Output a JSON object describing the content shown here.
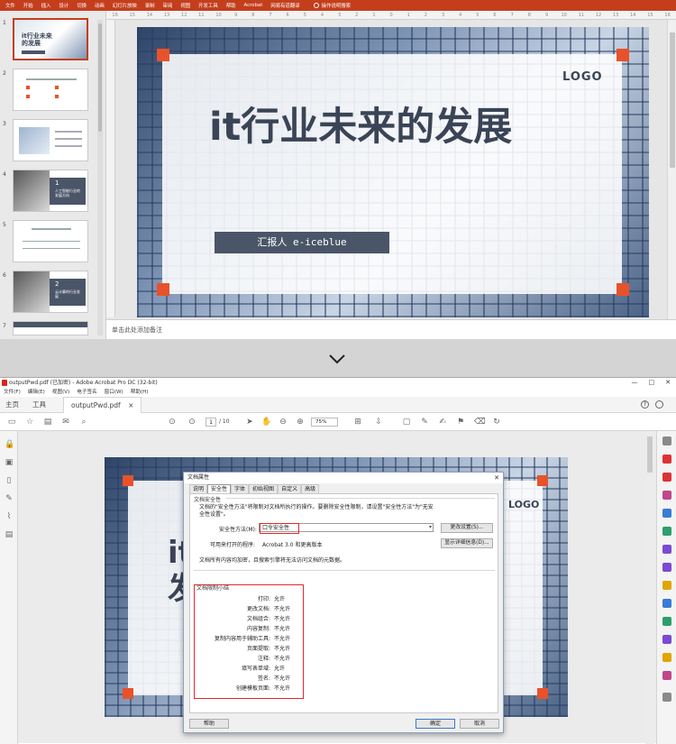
{
  "ppt": {
    "ribbon_tabs": [
      "文件",
      "开始",
      "插入",
      "设计",
      "切换",
      "动画",
      "幻灯片放映",
      "录制",
      "审阅",
      "视图",
      "开发工具",
      "帮助",
      "Acrobat",
      "网易有道翻译"
    ],
    "tell_me": "操作说明搜索",
    "ruler": [
      "16",
      "15",
      "14",
      "13",
      "12",
      "11",
      "10",
      "9",
      "8",
      "7",
      "6",
      "5",
      "4",
      "3",
      "2",
      "1",
      "0",
      "1",
      "2",
      "3",
      "4",
      "5",
      "6",
      "7",
      "8",
      "9",
      "10",
      "11",
      "12",
      "13",
      "14",
      "15",
      "16"
    ],
    "thumb_numbers": [
      "1",
      "2",
      "3",
      "4",
      "5",
      "6",
      "7"
    ],
    "thumb_texts": {
      "t1_title": "it行业未来的发展",
      "t4_num": "1",
      "t4_text": "人工智能行业的发展方向",
      "t6_num": "2",
      "t6_text": "云计算的行业发展"
    },
    "slide": {
      "title": "it行业未来的发展",
      "logo": "LOGO",
      "reporter": "汇报人 e-iceblue"
    },
    "notes_placeholder": "单击此处添加备注"
  },
  "acrobat": {
    "title": "outputPwd.pdf (已加密) - Adobe Acrobat Pro DC (32-bit)",
    "window_controls": [
      "—",
      "□",
      "✕"
    ],
    "menu": [
      "文件(F)",
      "编辑(E)",
      "视图(V)",
      "电子签名",
      "窗口(W)",
      "帮助(H)"
    ],
    "tabs": {
      "home": "主页",
      "tools": "工具",
      "doc": "outputPwd.pdf"
    },
    "page_current": "1",
    "page_total": "/ 10",
    "zoom": "75%",
    "pdf_logo": "LOGO",
    "pdf_title_partial": "it\n发",
    "dialog": {
      "title": "文档属性",
      "close": "✕",
      "tabs": [
        "说明",
        "安全性",
        "字体",
        "初始视图",
        "自定义",
        "高级"
      ],
      "section_security": "文档安全性",
      "desc": "文档的\"安全性方法\"将限制对文档所执行的操作。要删除安全性限制，请设置\"安全性方法\"为\"无安全性设置\"。",
      "method_label": "安全性方法(M):",
      "method_value": "口令安全性",
      "change_btn": "更改设置(S)...",
      "open_label": "可用来打开的程序:",
      "open_value": "Acrobat 3.0 和更高版本",
      "details_btn": "显示详细信息(D)...",
      "encrypt_note": "文档所有内容均加密，且搜索引擎将无法访问文档的元数据。",
      "section_restrict": "文档限制小结",
      "restrictions": [
        {
          "key": "打印:",
          "value": "允许"
        },
        {
          "key": "更改文档:",
          "value": "不允许"
        },
        {
          "key": "文档组合:",
          "value": "不允许"
        },
        {
          "key": "内容复制:",
          "value": "不允许"
        },
        {
          "key": "复制内容用于辅助工具:",
          "value": "不允许"
        },
        {
          "key": "页面提取:",
          "value": "不允许"
        },
        {
          "key": "注释:",
          "value": "不允许"
        },
        {
          "key": "填写表单域:",
          "value": "允许"
        },
        {
          "key": "签名:",
          "value": "不允许"
        },
        {
          "key": "创建模板页面:",
          "value": "不允许"
        }
      ],
      "help_btn": "帮助",
      "ok_btn": "确定",
      "cancel_btn": "取消"
    }
  },
  "colors": {
    "ppt_accent": "#c43e1c",
    "slide_orange": "#e8522b",
    "text_dark": "#3a4456",
    "highlight_red": "#e0282e"
  }
}
